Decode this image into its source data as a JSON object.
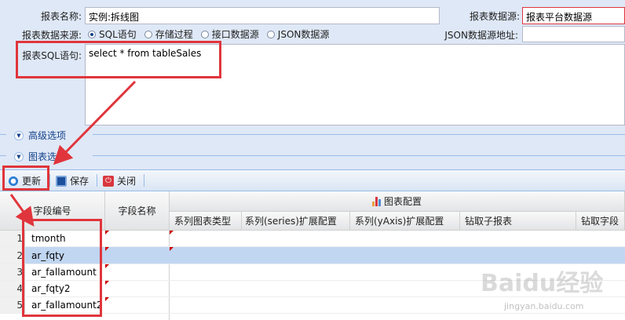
{
  "form": {
    "name_label": "报表名称:",
    "name_value": "实例:拆线图",
    "datasource_label": "报表数据源:",
    "datasource_value": "报表平台数据源",
    "source_type_label": "报表数据来源:",
    "source_types": [
      "SQL语句",
      "存储过程",
      "接口数据源",
      "JSON数据源"
    ],
    "selected_source_type": "SQL语句",
    "json_url_label": "JSON数据源地址:",
    "json_url_value": "",
    "sql_label": "报表SQL语句:",
    "sql_value": "select * from tableSales"
  },
  "sections": {
    "advanced": "高级选项",
    "chart": "图表选项"
  },
  "toolbar": {
    "refresh": "更新",
    "save": "保存",
    "close": "关闭"
  },
  "grid": {
    "headers": {
      "field_code": "字段编号",
      "field_name": "字段名称",
      "chart_config": "图表配置",
      "series_type": "系列图表类型",
      "series_ext": "系列(series)扩展配置",
      "yaxis_ext": "系列(yAxis)扩展配置",
      "drill_sub": "钻取子报表",
      "drill_field": "钻取字段"
    },
    "rows": [
      {
        "num": "1",
        "code": "tmonth"
      },
      {
        "num": "2",
        "code": "ar_fqty"
      },
      {
        "num": "3",
        "code": "ar_fallamount"
      },
      {
        "num": "4",
        "code": "ar_fqty2"
      },
      {
        "num": "5",
        "code": "ar_fallamount2"
      }
    ]
  },
  "watermark": {
    "brand": "Baidu经验",
    "url": "jingyan.baidu.com"
  },
  "colors": {
    "accent": "#15428b",
    "highlight": "#e0353c",
    "selected_row": "#c1d6f1"
  }
}
